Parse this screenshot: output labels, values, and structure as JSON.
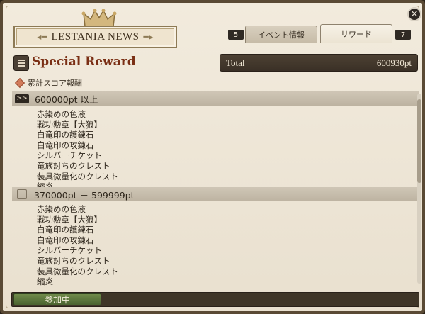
{
  "banner": {
    "title": "LESTANIA NEWS"
  },
  "close": {
    "glyph": "✕"
  },
  "tabs": {
    "prev_count": "5",
    "next_count": "7",
    "items": [
      {
        "label": "イベント情報",
        "active": false
      },
      {
        "label": "リワード",
        "active": true
      }
    ]
  },
  "title": "Special Reward",
  "total": {
    "label": "Total",
    "value": "600930pt"
  },
  "subheading": "累計スコア報酬",
  "sections": [
    {
      "range": "600000pt 以上",
      "icon_glyph": ">>",
      "items": [
        "赤染めの色液",
        "戦功勲章【大狼】",
        "白竜印の護錬石",
        "白竜印の攻錬石",
        "シルバーチケット",
        "竜族討ちのクレスト",
        "装具微量化のクレスト",
        "縮炎"
      ]
    },
    {
      "range": "370000pt － 599999pt",
      "icon_glyph": "",
      "items": [
        "赤染めの色液",
        "戦功勲章【大狼】",
        "白竜印の護錬石",
        "白竜印の攻錬石",
        "シルバーチケット",
        "竜族討ちのクレスト",
        "装具微量化のクレスト",
        "縮炎"
      ]
    }
  ],
  "footer": {
    "button_label": "参加中"
  },
  "colors": {
    "accent": "#7a2f14",
    "participate": "#5b7a3b",
    "panel": "#3f3527"
  }
}
